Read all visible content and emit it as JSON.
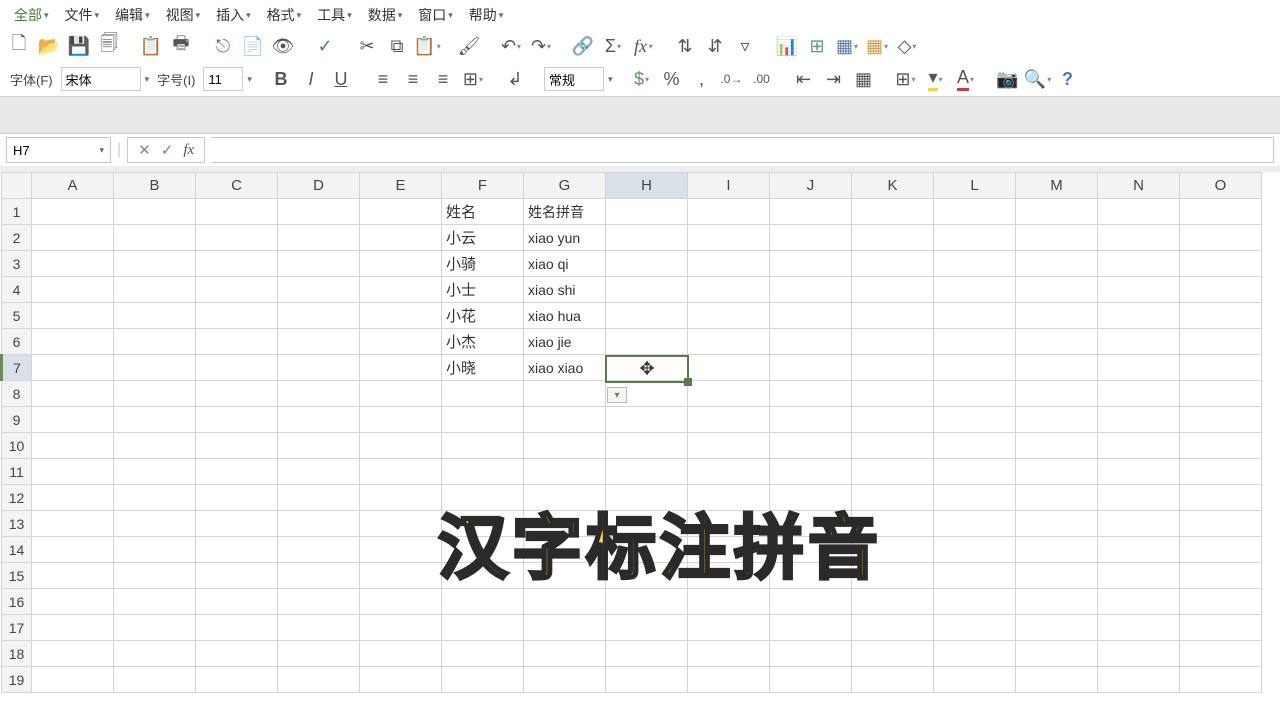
{
  "menu": [
    "全部",
    "文件",
    "编辑",
    "视图",
    "插入",
    "格式",
    "工具",
    "数据",
    "窗口",
    "帮助"
  ],
  "format_bar": {
    "label_font": "字体(F)",
    "font_name": "宋体",
    "label_size": "字号(I)",
    "font_size": "11",
    "style_label": "常规"
  },
  "namebox": {
    "cell_ref": "H7"
  },
  "columns": [
    "A",
    "B",
    "C",
    "D",
    "E",
    "F",
    "G",
    "H",
    "I",
    "J",
    "K",
    "L",
    "M",
    "N",
    "O"
  ],
  "row_count": 19,
  "selected_col_index": 7,
  "selected_row_index": 6,
  "cells": {
    "F1": "姓名",
    "G1": "姓名拼音",
    "F2": "小云",
    "G2": "xiao yun",
    "F3": "小骑",
    "G3": "xiao qi",
    "F4": "小士",
    "G4": "xiao shi",
    "F5": "小花",
    "G5": "xiao hua",
    "F6": "小杰",
    "G6": "xiao jie",
    "F7": "小晓",
    "G7": "xiao xiao"
  },
  "overlay_text": "汉字标注拼音",
  "icons": {
    "new": "🗋",
    "open": "📂",
    "save": "💾",
    "copy_doc": "🗐",
    "paste_special": "📋",
    "print": "🖶",
    "export": "⎋",
    "pdf": "📄",
    "cut": "✂",
    "copy": "⧉",
    "paste": "📋",
    "brush": "🖌",
    "undo": "↶",
    "redo": "↷",
    "sum": "Σ",
    "fx": "fx",
    "sort_asc": "⇅",
    "sort_desc": "⇵",
    "filter": "▿",
    "chart": "📊",
    "pivot": "⊞",
    "table": "▦",
    "shapes": "◇",
    "bold": "B",
    "italic": "I",
    "underline": "U",
    "align_left": "≡",
    "align_center": "≡",
    "align_right": "≡",
    "merge": "⊞",
    "wrap": "↲",
    "currency": "$",
    "percent": "%",
    "comma": ",",
    "inc_dec": ".0",
    "dec_dec": ".00",
    "borders": "⊞",
    "bg_color": "▾",
    "font_color": "A",
    "find": "🔍",
    "help": "?"
  }
}
